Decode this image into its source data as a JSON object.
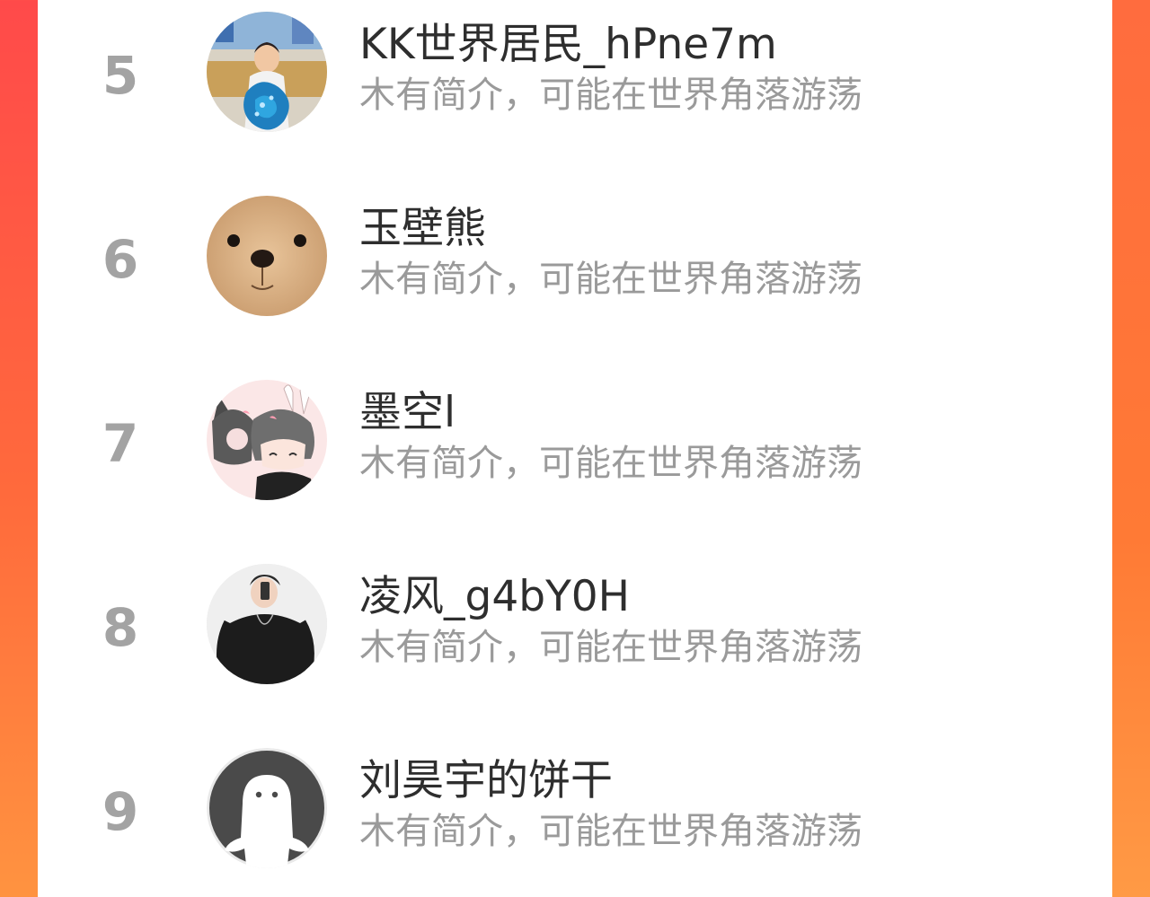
{
  "ranking": {
    "items": [
      {
        "rank": "5",
        "name": "KK世界居民_hPne7m",
        "desc": "木有简介，可能在世界角落游荡",
        "avatar_icon": "kid-with-balloon-avatar"
      },
      {
        "rank": "6",
        "name": "玉壁熊",
        "desc": "木有简介，可能在世界角落游荡",
        "avatar_icon": "teddy-bear-avatar"
      },
      {
        "rank": "7",
        "name": "墨空l",
        "desc": "木有简介，可能在世界角落游荡",
        "avatar_icon": "anime-couple-avatar"
      },
      {
        "rank": "8",
        "name": "凌风_g4bY0H",
        "desc": "木有简介，可能在世界角落游荡",
        "avatar_icon": "mirror-selfie-avatar"
      },
      {
        "rank": "9",
        "name": "刘昊宇的饼干",
        "desc": "木有简介，可能在世界角落游荡",
        "avatar_icon": "default-ghost-avatar"
      }
    ]
  },
  "colors": {
    "background_gradient_top": "#ff4a4a",
    "background_gradient_bottom": "#ff9340",
    "rank_text": "#a3a3a3",
    "name_text": "#2e2e2e",
    "desc_text": "#9a9a9a"
  }
}
